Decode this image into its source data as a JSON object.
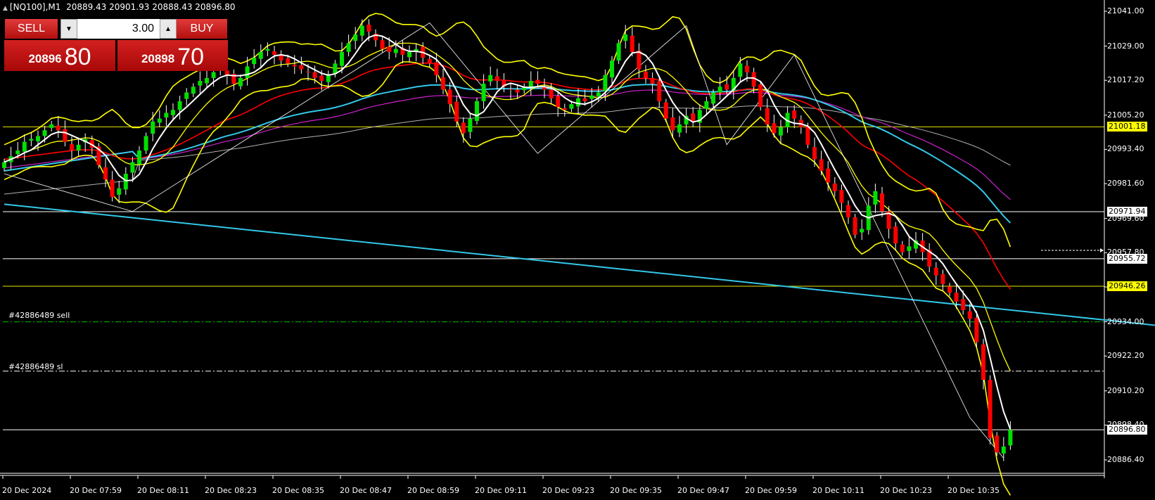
{
  "header": {
    "symbol": "[NQ100],M1",
    "ohlc": "20889.43 20901.93 20888.43 20896.80"
  },
  "trade_panel": {
    "sell_label": "SELL",
    "buy_label": "BUY",
    "lot": "3.00",
    "sell_price_big": "20896",
    "sell_price_pts": "80",
    "buy_price_big": "20898",
    "buy_price_pts": "70"
  },
  "trade_labels": {
    "order_sell": "#42886489 sell",
    "order_sl": "#42886489 sl"
  },
  "colors": {
    "bull": "#00e000",
    "bear": "#ff0000",
    "bollinger": "#ffff00",
    "ma_red": "#ff0000",
    "ma_cyan": "#33c8e8",
    "ma_magenta": "#cc22cc",
    "ma_gray": "#b0b0b0",
    "trendline": "#33c8e8",
    "hline_yellow": "#e8e800",
    "hline_white": "#ffffff",
    "order_green": "#00c000"
  },
  "chart_data": {
    "type": "candlestick",
    "symbol": "[NQ100]",
    "timeframe": "M1",
    "ylim": [
      20881.5,
      21046.0
    ],
    "price_ticks": [
      "21041.00",
      "21029.00",
      "21017.20",
      "21005.20",
      "20993.40",
      "20981.60",
      "20969.60",
      "20957.80",
      "20946.00",
      "20934.00",
      "20922.20",
      "20910.20",
      "20898.40",
      "20886.40"
    ],
    "time_ticks": [
      "20 Dec 2024",
      "20 Dec 07:59",
      "20 Dec 08:11",
      "20 Dec 08:23",
      "20 Dec 08:35",
      "20 Dec 08:47",
      "20 Dec 08:59",
      "20 Dec 09:11",
      "20 Dec 09:23",
      "20 Dec 09:35",
      "20 Dec 09:47",
      "20 Dec 09:59",
      "20 Dec 10:11",
      "20 Dec 10:23",
      "20 Dec 10:35"
    ],
    "price_tags": [
      {
        "value": 21001.18,
        "label": "21001.18",
        "style": "yellow"
      },
      {
        "value": 20971.94,
        "label": "20971.94",
        "style": "white"
      },
      {
        "value": 20955.72,
        "label": "20955.72",
        "style": "white"
      },
      {
        "value": 20946.26,
        "label": "20946.26",
        "style": "yellow"
      },
      {
        "value": 20896.8,
        "label": "20896.80",
        "style": "white"
      }
    ],
    "hlines": [
      {
        "value": 21001.18,
        "color": "yellow",
        "style": "solid"
      },
      {
        "value": 20971.94,
        "color": "white",
        "style": "solid"
      },
      {
        "value": 20955.72,
        "color": "white",
        "style": "solid"
      },
      {
        "value": 20946.26,
        "color": "yellow",
        "style": "solid"
      },
      {
        "value": 20934.0,
        "color": "green",
        "style": "dashdot"
      },
      {
        "value": 20917.0,
        "color": "white",
        "style": "dashdot"
      },
      {
        "value": 20896.8,
        "color": "white",
        "style": "solid"
      }
    ],
    "closes": [
      20989,
      20991,
      20993,
      20996,
      20997,
      20998,
      21000,
      21002,
      21000,
      20996,
      20993,
      20995,
      20997,
      20994,
      20988,
      20983,
      20977,
      20980,
      20985,
      20989,
      20993,
      20998,
      21003,
      21004,
      21006,
      21007,
      21010,
      21013,
      21015,
      21017,
      21018,
      21020,
      21021,
      21019,
      21016,
      21018,
      21022,
      21025,
      21027,
      21028,
      21026,
      21024,
      21023,
      21022,
      21021,
      21020,
      21018,
      21017,
      21019,
      21023,
      21027,
      21030,
      21033,
      21036,
      21034,
      21031,
      21028,
      21027,
      21028,
      21026,
      21027,
      21028,
      21025,
      21023,
      21019,
      21014,
      21009,
      21003,
      20999,
      21004,
      21010,
      21016,
      21019,
      21017,
      21015,
      21014,
      21013,
      21015,
      21017,
      21016,
      21014,
      21011,
      21008,
      21007,
      21009,
      21011,
      21010,
      21012,
      21013,
      21019,
      21024,
      21030,
      21033,
      21027,
      21021,
      21018,
      21016,
      21010,
      21004,
      21000,
      21002,
      21005,
      21003,
      21007,
      21010,
      21013,
      21015,
      21014,
      21018,
      21023,
      21020,
      21015,
      21008,
      21002,
      20999,
      21001,
      21006,
      21004,
      21001,
      20995,
      20990,
      20986,
      20982,
      20979,
      20975,
      20970,
      20964,
      20966,
      20974,
      20979,
      20972,
      20966,
      20961,
      20958,
      20960,
      20962,
      20958,
      20953,
      20950,
      20947,
      20944,
      20941,
      20938,
      20935,
      20927,
      20914,
      20894,
      20889,
      20891,
      20896.8
    ],
    "series": [
      {
        "name": "",
        "kind": "bollinger_upper",
        "color": "yellow"
      },
      {
        "name": "",
        "kind": "bollinger_lower",
        "color": "yellow"
      },
      {
        "name": "",
        "kind": "ma_fast",
        "color": "white"
      },
      {
        "name": "",
        "kind": "ma_red",
        "color": "red"
      },
      {
        "name": "",
        "kind": "ma_cyan",
        "color": "cyan"
      },
      {
        "name": "",
        "kind": "ma_magenta",
        "color": "magenta"
      },
      {
        "name": "",
        "kind": "ma_slow",
        "color": "gray"
      }
    ],
    "trendline": {
      "from": [
        0,
        20974.5
      ],
      "to": [
        186,
        20929.0
      ]
    },
    "zigzag": [
      [
        0,
        20985
      ],
      [
        19,
        20972
      ],
      [
        63,
        21037
      ],
      [
        79,
        20992
      ],
      [
        101,
        21036
      ],
      [
        107,
        20995
      ],
      [
        117,
        21026
      ],
      [
        143,
        20901
      ],
      [
        148,
        20887
      ]
    ]
  }
}
